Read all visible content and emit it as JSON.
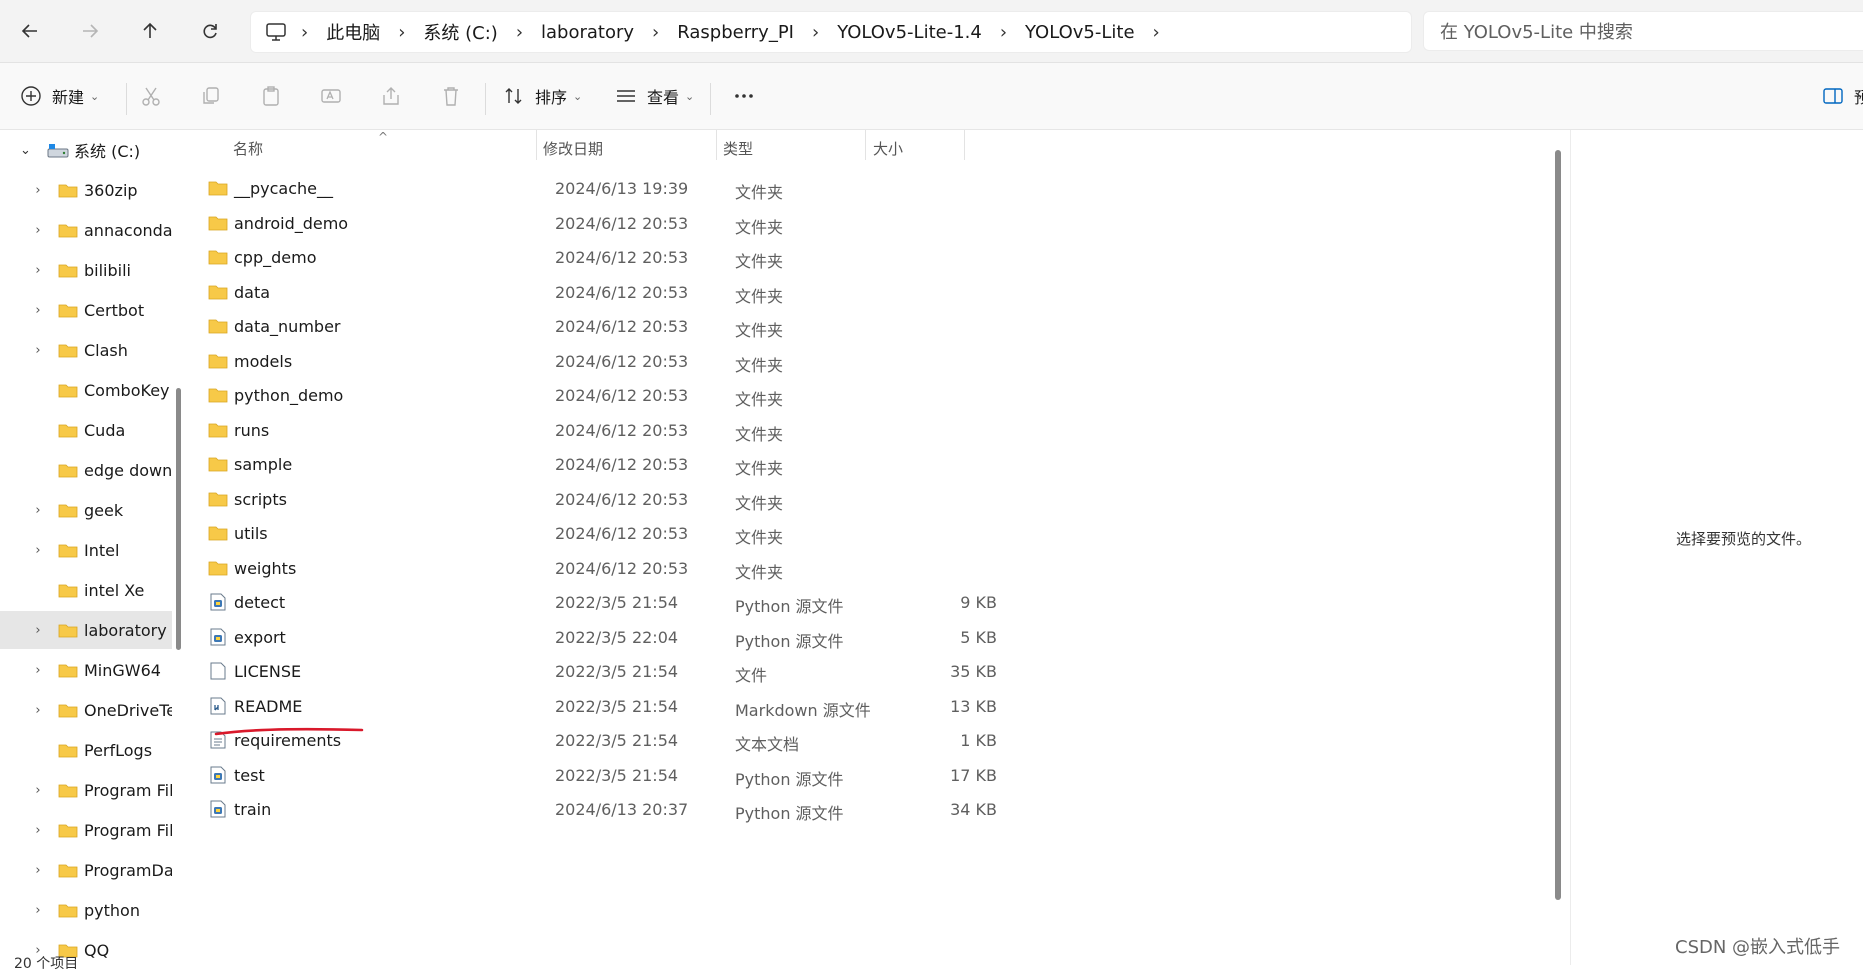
{
  "breadcrumb": {
    "items": [
      "此电脑",
      "系统 (C:)",
      "laboratory",
      "Raspberry_PI",
      "YOLOv5-Lite-1.4",
      "YOLOv5-Lite"
    ]
  },
  "search": {
    "placeholder": "在 YOLOv5-Lite 中搜索"
  },
  "commandbar": {
    "new_label": "新建",
    "sort_label": "排序",
    "view_label": "查看",
    "preview_label": "预"
  },
  "sidebar": {
    "root_label": "系统 (C:)",
    "items": [
      {
        "label": "360zip",
        "expandable": true
      },
      {
        "label": "annaconda",
        "expandable": true
      },
      {
        "label": "bilibili",
        "expandable": true
      },
      {
        "label": "Certbot",
        "expandable": true
      },
      {
        "label": "Clash",
        "expandable": true
      },
      {
        "label": "ComboKey",
        "expandable": false
      },
      {
        "label": "Cuda",
        "expandable": false
      },
      {
        "label": "edge downl",
        "expandable": false
      },
      {
        "label": "geek",
        "expandable": true
      },
      {
        "label": "Intel",
        "expandable": true
      },
      {
        "label": "intel Xe",
        "expandable": false
      },
      {
        "label": "laboratory",
        "expandable": true,
        "selected": true
      },
      {
        "label": "MinGW64",
        "expandable": true
      },
      {
        "label": "OneDriveTe",
        "expandable": true
      },
      {
        "label": "PerfLogs",
        "expandable": false
      },
      {
        "label": "Program File",
        "expandable": true
      },
      {
        "label": "Program File",
        "expandable": true
      },
      {
        "label": "ProgramDat",
        "expandable": true
      },
      {
        "label": "python",
        "expandable": true
      },
      {
        "label": "QQ",
        "expandable": true
      }
    ]
  },
  "filelist": {
    "columns": {
      "name": "名称",
      "date": "修改日期",
      "type": "类型",
      "size": "大小"
    },
    "rows": [
      {
        "name": "__pycache__",
        "date": "2024/6/13 19:39",
        "type": "文件夹",
        "size": "",
        "icon": "folder-icon"
      },
      {
        "name": "android_demo",
        "date": "2024/6/12 20:53",
        "type": "文件夹",
        "size": "",
        "icon": "folder-icon"
      },
      {
        "name": "cpp_demo",
        "date": "2024/6/12 20:53",
        "type": "文件夹",
        "size": "",
        "icon": "folder-icon"
      },
      {
        "name": "data",
        "date": "2024/6/12 20:53",
        "type": "文件夹",
        "size": "",
        "icon": "folder-icon"
      },
      {
        "name": "data_number",
        "date": "2024/6/12 20:53",
        "type": "文件夹",
        "size": "",
        "icon": "folder-icon"
      },
      {
        "name": "models",
        "date": "2024/6/12 20:53",
        "type": "文件夹",
        "size": "",
        "icon": "folder-icon"
      },
      {
        "name": "python_demo",
        "date": "2024/6/12 20:53",
        "type": "文件夹",
        "size": "",
        "icon": "folder-icon"
      },
      {
        "name": "runs",
        "date": "2024/6/12 20:53",
        "type": "文件夹",
        "size": "",
        "icon": "folder-icon"
      },
      {
        "name": "sample",
        "date": "2024/6/12 20:53",
        "type": "文件夹",
        "size": "",
        "icon": "folder-icon"
      },
      {
        "name": "scripts",
        "date": "2024/6/12 20:53",
        "type": "文件夹",
        "size": "",
        "icon": "folder-icon"
      },
      {
        "name": "utils",
        "date": "2024/6/12 20:53",
        "type": "文件夹",
        "size": "",
        "icon": "folder-icon"
      },
      {
        "name": "weights",
        "date": "2024/6/12 20:53",
        "type": "文件夹",
        "size": "",
        "icon": "folder-icon"
      },
      {
        "name": "detect",
        "date": "2022/3/5 21:54",
        "type": "Python 源文件",
        "size": "9 KB",
        "icon": "python-file-icon"
      },
      {
        "name": "export",
        "date": "2022/3/5 22:04",
        "type": "Python 源文件",
        "size": "5 KB",
        "icon": "python-file-icon"
      },
      {
        "name": "LICENSE",
        "date": "2022/3/5 21:54",
        "type": "文件",
        "size": "35 KB",
        "icon": "file-icon"
      },
      {
        "name": "README",
        "date": "2022/3/5 21:54",
        "type": "Markdown 源文件",
        "size": "13 KB",
        "icon": "markdown-file-icon"
      },
      {
        "name": "requirements",
        "date": "2022/3/5 21:54",
        "type": "文本文档",
        "size": "1 KB",
        "icon": "text-file-icon"
      },
      {
        "name": "test",
        "date": "2022/3/5 21:54",
        "type": "Python 源文件",
        "size": "17 KB",
        "icon": "python-file-icon"
      },
      {
        "name": "train",
        "date": "2024/6/13 20:37",
        "type": "Python 源文件",
        "size": "34 KB",
        "icon": "python-file-icon"
      }
    ]
  },
  "preview": {
    "message": "选择要预览的文件。"
  },
  "status": {
    "item_count": "20 个项目"
  },
  "watermark": "CSDN @嵌入式低手",
  "colors": {
    "folder": "#f7c948",
    "annotation": "#d9192b",
    "accent": "#0067c0"
  }
}
